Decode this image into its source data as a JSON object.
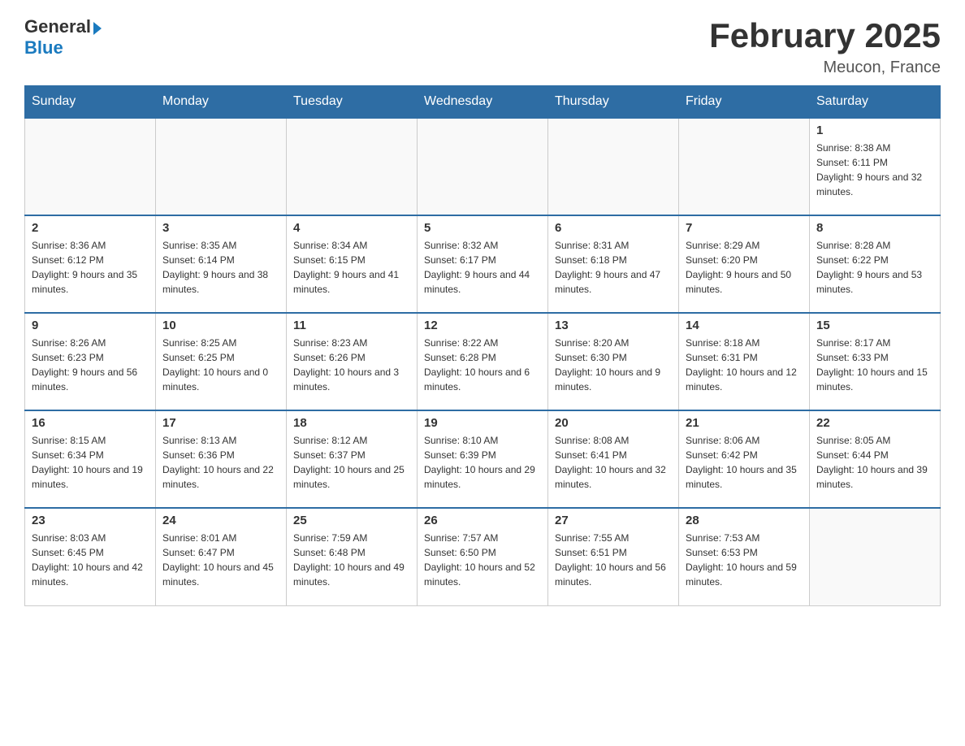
{
  "header": {
    "logo": {
      "general": "General",
      "arrow": "▶",
      "blue": "Blue"
    },
    "title": "February 2025",
    "location": "Meucon, France"
  },
  "days_of_week": [
    "Sunday",
    "Monday",
    "Tuesday",
    "Wednesday",
    "Thursday",
    "Friday",
    "Saturday"
  ],
  "weeks": [
    [
      {
        "day": "",
        "info": ""
      },
      {
        "day": "",
        "info": ""
      },
      {
        "day": "",
        "info": ""
      },
      {
        "day": "",
        "info": ""
      },
      {
        "day": "",
        "info": ""
      },
      {
        "day": "",
        "info": ""
      },
      {
        "day": "1",
        "info": "Sunrise: 8:38 AM\nSunset: 6:11 PM\nDaylight: 9 hours and 32 minutes."
      }
    ],
    [
      {
        "day": "2",
        "info": "Sunrise: 8:36 AM\nSunset: 6:12 PM\nDaylight: 9 hours and 35 minutes."
      },
      {
        "day": "3",
        "info": "Sunrise: 8:35 AM\nSunset: 6:14 PM\nDaylight: 9 hours and 38 minutes."
      },
      {
        "day": "4",
        "info": "Sunrise: 8:34 AM\nSunset: 6:15 PM\nDaylight: 9 hours and 41 minutes."
      },
      {
        "day": "5",
        "info": "Sunrise: 8:32 AM\nSunset: 6:17 PM\nDaylight: 9 hours and 44 minutes."
      },
      {
        "day": "6",
        "info": "Sunrise: 8:31 AM\nSunset: 6:18 PM\nDaylight: 9 hours and 47 minutes."
      },
      {
        "day": "7",
        "info": "Sunrise: 8:29 AM\nSunset: 6:20 PM\nDaylight: 9 hours and 50 minutes."
      },
      {
        "day": "8",
        "info": "Sunrise: 8:28 AM\nSunset: 6:22 PM\nDaylight: 9 hours and 53 minutes."
      }
    ],
    [
      {
        "day": "9",
        "info": "Sunrise: 8:26 AM\nSunset: 6:23 PM\nDaylight: 9 hours and 56 minutes."
      },
      {
        "day": "10",
        "info": "Sunrise: 8:25 AM\nSunset: 6:25 PM\nDaylight: 10 hours and 0 minutes."
      },
      {
        "day": "11",
        "info": "Sunrise: 8:23 AM\nSunset: 6:26 PM\nDaylight: 10 hours and 3 minutes."
      },
      {
        "day": "12",
        "info": "Sunrise: 8:22 AM\nSunset: 6:28 PM\nDaylight: 10 hours and 6 minutes."
      },
      {
        "day": "13",
        "info": "Sunrise: 8:20 AM\nSunset: 6:30 PM\nDaylight: 10 hours and 9 minutes."
      },
      {
        "day": "14",
        "info": "Sunrise: 8:18 AM\nSunset: 6:31 PM\nDaylight: 10 hours and 12 minutes."
      },
      {
        "day": "15",
        "info": "Sunrise: 8:17 AM\nSunset: 6:33 PM\nDaylight: 10 hours and 15 minutes."
      }
    ],
    [
      {
        "day": "16",
        "info": "Sunrise: 8:15 AM\nSunset: 6:34 PM\nDaylight: 10 hours and 19 minutes."
      },
      {
        "day": "17",
        "info": "Sunrise: 8:13 AM\nSunset: 6:36 PM\nDaylight: 10 hours and 22 minutes."
      },
      {
        "day": "18",
        "info": "Sunrise: 8:12 AM\nSunset: 6:37 PM\nDaylight: 10 hours and 25 minutes."
      },
      {
        "day": "19",
        "info": "Sunrise: 8:10 AM\nSunset: 6:39 PM\nDaylight: 10 hours and 29 minutes."
      },
      {
        "day": "20",
        "info": "Sunrise: 8:08 AM\nSunset: 6:41 PM\nDaylight: 10 hours and 32 minutes."
      },
      {
        "day": "21",
        "info": "Sunrise: 8:06 AM\nSunset: 6:42 PM\nDaylight: 10 hours and 35 minutes."
      },
      {
        "day": "22",
        "info": "Sunrise: 8:05 AM\nSunset: 6:44 PM\nDaylight: 10 hours and 39 minutes."
      }
    ],
    [
      {
        "day": "23",
        "info": "Sunrise: 8:03 AM\nSunset: 6:45 PM\nDaylight: 10 hours and 42 minutes."
      },
      {
        "day": "24",
        "info": "Sunrise: 8:01 AM\nSunset: 6:47 PM\nDaylight: 10 hours and 45 minutes."
      },
      {
        "day": "25",
        "info": "Sunrise: 7:59 AM\nSunset: 6:48 PM\nDaylight: 10 hours and 49 minutes."
      },
      {
        "day": "26",
        "info": "Sunrise: 7:57 AM\nSunset: 6:50 PM\nDaylight: 10 hours and 52 minutes."
      },
      {
        "day": "27",
        "info": "Sunrise: 7:55 AM\nSunset: 6:51 PM\nDaylight: 10 hours and 56 minutes."
      },
      {
        "day": "28",
        "info": "Sunrise: 7:53 AM\nSunset: 6:53 PM\nDaylight: 10 hours and 59 minutes."
      },
      {
        "day": "",
        "info": ""
      }
    ]
  ]
}
